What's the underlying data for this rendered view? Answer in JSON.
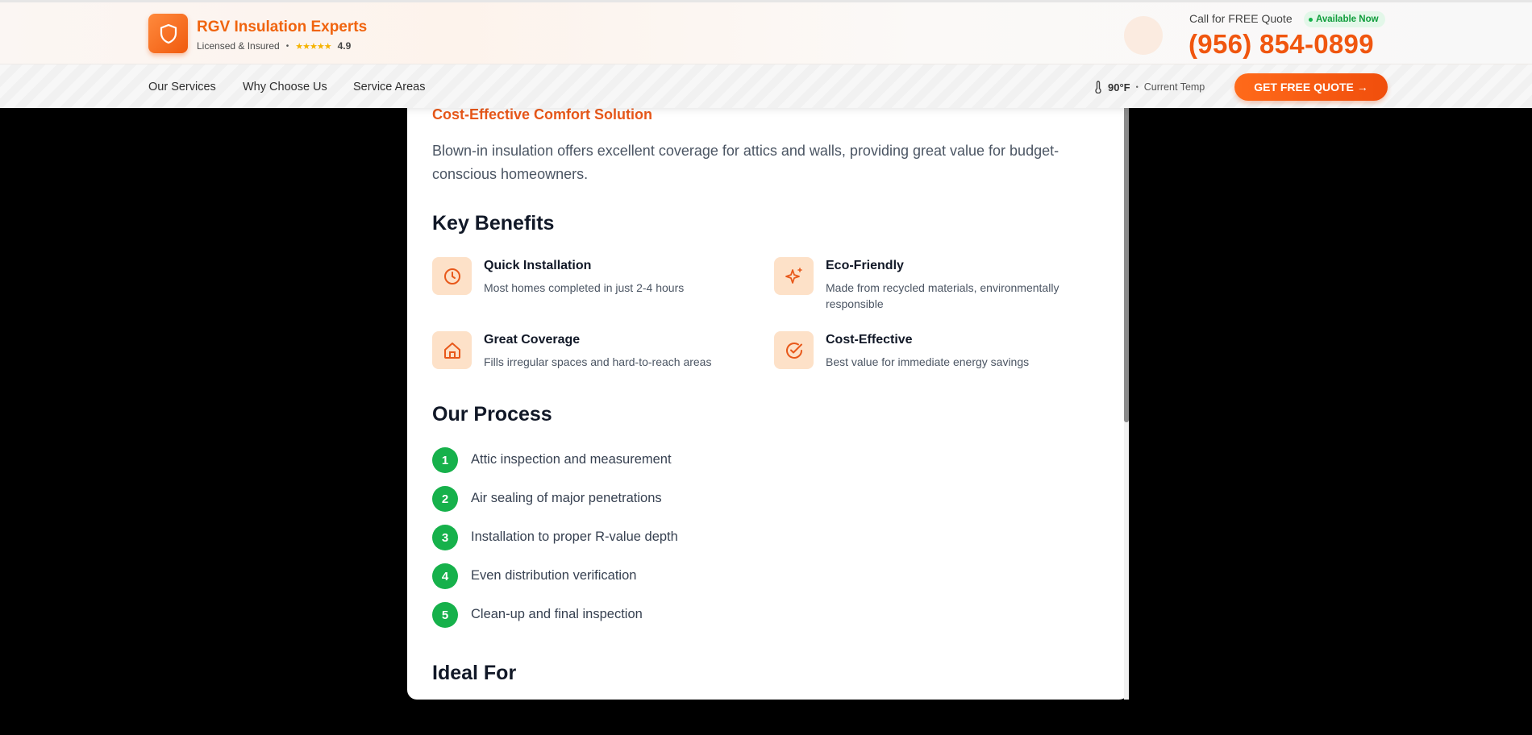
{
  "header": {
    "brand_name": "RGV Insulation Experts",
    "licensed": "Licensed & Insured",
    "separator": "•",
    "stars": "★★★★★",
    "rating": "4.9",
    "call_label": "Call for FREE Quote",
    "available": "Available Now",
    "phone": "(956) 854-0899",
    "logo_icon": "shield-icon"
  },
  "nav": {
    "items": [
      "Our Services",
      "Why Choose Us",
      "Service Areas"
    ],
    "temp_value": "90°F",
    "temp_sep": "•",
    "temp_label": "Current Temp",
    "cta": "GET FREE QUOTE →"
  },
  "colors": {
    "accent": "#f0560f",
    "green": "#16b14b",
    "icon_bg": "#fde1c8"
  },
  "panel": {
    "subtitle": "Cost-Effective Comfort Solution",
    "description": "Blown-in insulation offers excellent coverage for attics and walls, providing great value for budget-conscious homeowners.",
    "benefits_heading": "Key Benefits",
    "benefits": [
      {
        "icon": "clock-icon",
        "title": "Quick Installation",
        "desc": "Most homes completed in just 2-4 hours"
      },
      {
        "icon": "sparkles-icon",
        "title": "Eco-Friendly",
        "desc": "Made from recycled materials, environmentally responsible"
      },
      {
        "icon": "home-icon",
        "title": "Great Coverage",
        "desc": "Fills irregular spaces and hard-to-reach areas"
      },
      {
        "icon": "check-circle-icon",
        "title": "Cost-Effective",
        "desc": "Best value for immediate energy savings"
      }
    ],
    "process_heading": "Our Process",
    "steps": [
      {
        "num": "1",
        "text": "Attic inspection and measurement"
      },
      {
        "num": "2",
        "text": "Air sealing of major penetrations"
      },
      {
        "num": "3",
        "text": "Installation to proper R-value depth"
      },
      {
        "num": "4",
        "text": "Even distribution verification"
      },
      {
        "num": "5",
        "text": "Clean-up and final inspection"
      }
    ],
    "ideal_heading": "Ideal For"
  }
}
